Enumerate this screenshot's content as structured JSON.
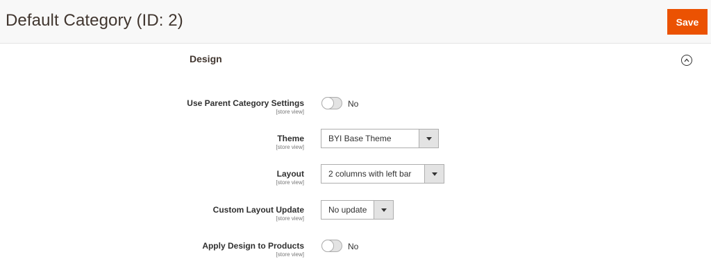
{
  "header": {
    "title": "Default Category (ID: 2)",
    "save_label": "Save"
  },
  "section": {
    "title": "Design",
    "collapse_icon": "chevron-up-circle-icon"
  },
  "fields": {
    "use_parent": {
      "label": "Use Parent Category Settings",
      "scope": "[store view]",
      "value": "No"
    },
    "theme": {
      "label": "Theme",
      "scope": "[store view]",
      "value": "BYI Base Theme"
    },
    "layout": {
      "label": "Layout",
      "scope": "[store view]",
      "value": "2 columns with left bar"
    },
    "custom_layout": {
      "label": "Custom Layout Update",
      "scope": "[store view]",
      "value": "No update"
    },
    "apply_design": {
      "label": "Apply Design to Products",
      "scope": "[store view]",
      "value": "No"
    }
  },
  "colors": {
    "accent": "#eb5202",
    "header_bg": "#f8f8f8",
    "title_text": "#41362f"
  }
}
